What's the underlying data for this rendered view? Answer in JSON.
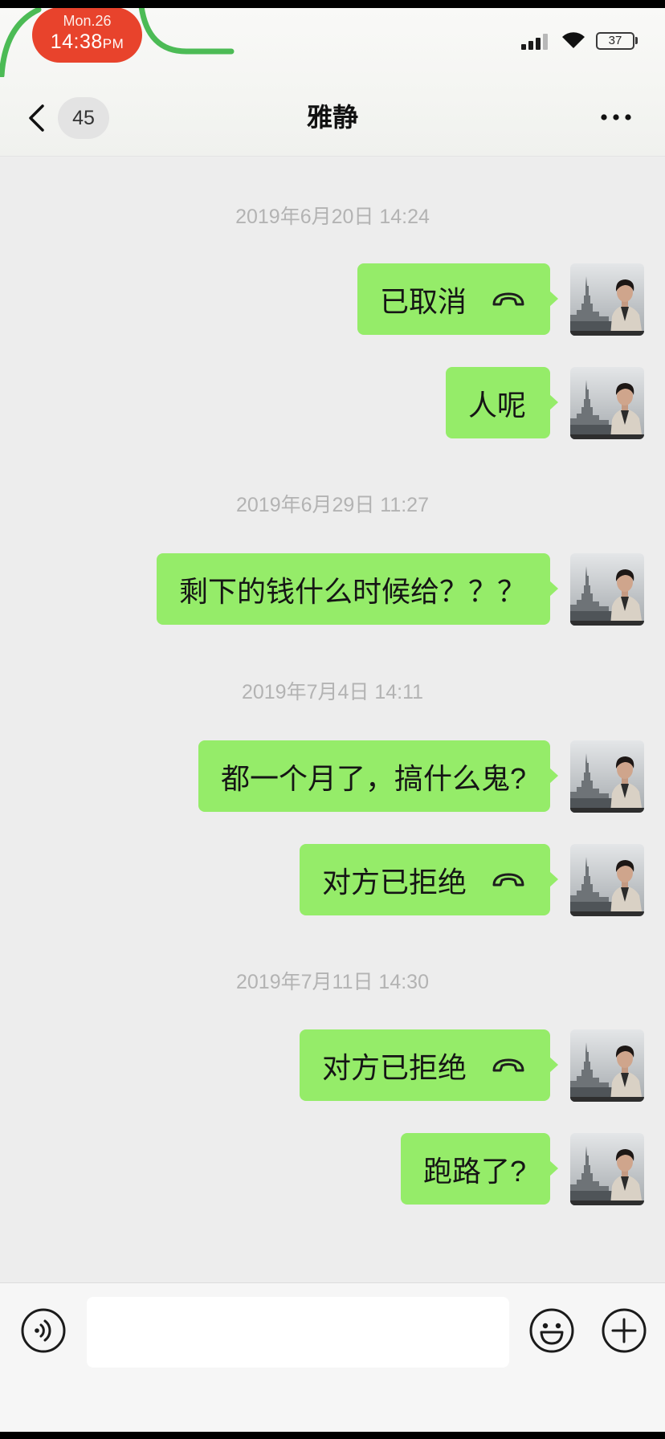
{
  "status_bar": {
    "date": "Mon.26",
    "time": "14:38",
    "ampm": "PM",
    "signal_icon": "cellular-signal-icon",
    "wifi_icon": "wifi-icon",
    "battery_icon": "battery-icon",
    "battery_level": "37"
  },
  "header": {
    "back_icon": "chevron-left-icon",
    "unread_count": "45",
    "title": "雅静",
    "more_icon": "more-dots-icon"
  },
  "chat": {
    "items": [
      {
        "timestamp": "2019年6月20日 14:24"
      },
      {
        "text": "已取消",
        "icon": "phone-hangup-icon"
      },
      {
        "text": "人呢"
      },
      {
        "timestamp": "2019年6月29日 11:27"
      },
      {
        "text": "剩下的钱什么时候给？？？"
      },
      {
        "timestamp": "2019年7月4日 14:11"
      },
      {
        "text": "都一个月了，搞什么鬼?"
      },
      {
        "text": "对方已拒绝",
        "icon": "phone-hangup-icon"
      },
      {
        "timestamp": "2019年7月11日 14:30"
      },
      {
        "text": "对方已拒绝",
        "icon": "phone-hangup-icon"
      },
      {
        "text": "跑路了?"
      }
    ]
  },
  "input_bar": {
    "voice_icon": "voice-input-icon",
    "input_value": "",
    "emoji_icon": "emoji-icon",
    "plus_icon": "plus-icon"
  },
  "colors": {
    "bubble": "#95ec69",
    "chat_bg": "#ededed",
    "status_pill": "#e8432c",
    "timestamp": "#b3b3b3",
    "decor_line": "#4cbb55"
  }
}
